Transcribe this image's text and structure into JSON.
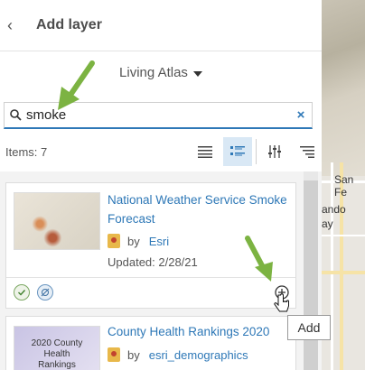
{
  "header": {
    "back_glyph": "‹",
    "title": "Add layer"
  },
  "source": {
    "label": "Living Atlas"
  },
  "search": {
    "value": "smoke",
    "clear_glyph": "×"
  },
  "toolbar": {
    "items_label": "Items: 7"
  },
  "results": [
    {
      "title": "National Weather Service Smoke Forecast",
      "by": "by",
      "owner": "Esri",
      "updated": "Updated: 2/28/21"
    },
    {
      "title": "County Health Rankings 2020",
      "by": "by",
      "owner": "esri_demographics",
      "thumb_text": "2020 County Health Rankings"
    }
  ],
  "tooltip": {
    "text": "Add"
  },
  "map": {
    "label_1": "San Fe",
    "label_2": "ando",
    "label_3": "ay"
  },
  "colors": {
    "accent": "#2e78b7",
    "arrow": "#7cb342",
    "badge": "#e8b84a"
  }
}
